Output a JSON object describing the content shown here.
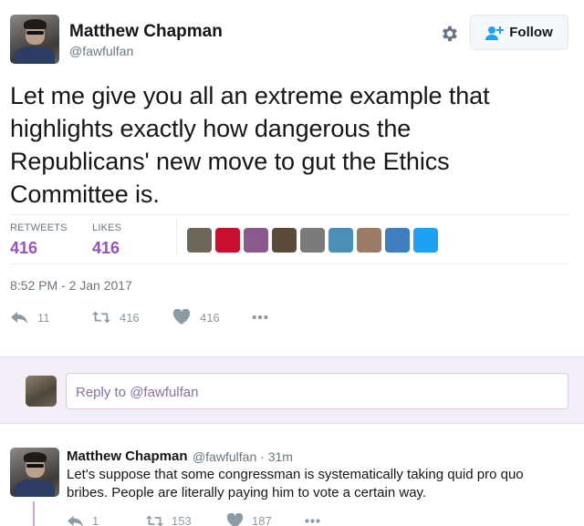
{
  "author": {
    "name": "Matthew Chapman",
    "handle": "@fawfulfan"
  },
  "follow_button": {
    "label": "Follow",
    "icon": "add-user-icon"
  },
  "settings_icon": "gear-icon",
  "tweet": {
    "text": "Let me give you all an extreme example that highlights exactly how dangerous the Republicans' new move to gut the Ethics Committee is.",
    "timestamp": "8:52 PM - 2 Jan 2017"
  },
  "stats": {
    "retweets_label": "RETWEETS",
    "retweets_value": "416",
    "likes_label": "LIKES",
    "likes_value": "416"
  },
  "likers": [
    {
      "name": "liker-1",
      "color": "#6d6558"
    },
    {
      "name": "liker-2",
      "color": "#c8102e"
    },
    {
      "name": "liker-3",
      "color": "#8a5a8c"
    },
    {
      "name": "liker-4",
      "color": "#5a4a3a"
    },
    {
      "name": "liker-5",
      "color": "#7b7a78"
    },
    {
      "name": "liker-6",
      "color": "#4a8fb5"
    },
    {
      "name": "liker-7",
      "color": "#9b7a66"
    },
    {
      "name": "liker-8",
      "color": "#3f7fbf"
    },
    {
      "name": "liker-9",
      "color": "#1da1f2"
    }
  ],
  "actions": {
    "reply_count": "11",
    "retweet_count": "416",
    "like_count": "416"
  },
  "reply_box": {
    "placeholder": "Reply to @fawfulfan"
  },
  "reply_tweet": {
    "name": "Matthew Chapman",
    "meta": "@fawfulfan · 31m",
    "text": "Let's suppose that some congressman is systematically taking quid pro quo bribes. People are literally paying him to vote a certain way.",
    "reply_count": "1",
    "retweet_count": "153",
    "like_count": "187"
  },
  "colors": {
    "accent": "#9b4fc4",
    "reply_area": "#f4eef8",
    "muted": "#657786"
  }
}
